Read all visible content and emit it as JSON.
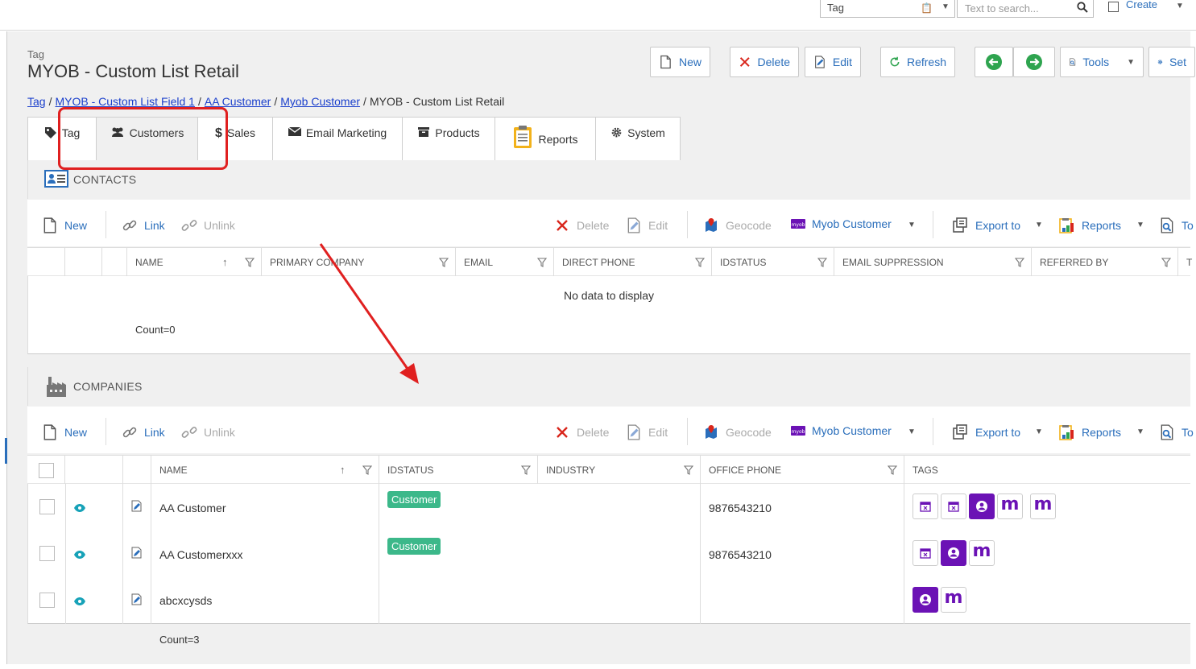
{
  "topbar": {
    "tag_select_value": "Tag",
    "search_placeholder": "Text to search...",
    "create_label": "Create"
  },
  "header": {
    "kicker": "Tag",
    "title": "MYOB - Custom List Retail"
  },
  "toolbar": {
    "new_label": "New",
    "delete_label": "Delete",
    "edit_label": "Edit",
    "refresh_label": "Refresh",
    "tools_label": "Tools",
    "settings_label": "Set"
  },
  "breadcrumb": {
    "items": [
      "Tag",
      "MYOB - Custom List Field 1",
      "AA Customer",
      "Myob Customer"
    ],
    "current": "MYOB - Custom List Retail",
    "sep": "/"
  },
  "tabs": [
    {
      "label": "Tag",
      "icon": "tag-icon"
    },
    {
      "label": "Customers",
      "icon": "users-icon"
    },
    {
      "label": "Sales",
      "icon": "dollar-icon"
    },
    {
      "label": "Email Marketing",
      "icon": "envelope-icon"
    },
    {
      "label": "Products",
      "icon": "inbox-icon"
    },
    {
      "label": "Reports",
      "icon": "clipboard-icon"
    },
    {
      "label": "System",
      "icon": "gear-icon"
    }
  ],
  "contacts": {
    "title": "CONTACTS",
    "tools": {
      "new": "New",
      "link": "Link",
      "unlink": "Unlink",
      "delete": "Delete",
      "edit": "Edit",
      "geocode": "Geocode",
      "myob": "Myob Customer",
      "export": "Export to",
      "reports": "Reports",
      "more": "To"
    },
    "columns": [
      "NAME",
      "PRIMARY COMPANY",
      "EMAIL",
      "DIRECT PHONE",
      "IDSTATUS",
      "EMAIL SUPPRESSION",
      "REFERRED BY",
      "T"
    ],
    "no_data": "No data to display",
    "count": "Count=0"
  },
  "companies": {
    "title": "COMPANIES",
    "tools": {
      "new": "New",
      "link": "Link",
      "unlink": "Unlink",
      "delete": "Delete",
      "edit": "Edit",
      "geocode": "Geocode",
      "myob": "Myob Customer",
      "export": "Export to",
      "reports": "Reports",
      "more": "To"
    },
    "columns": [
      "NAME",
      "IDSTATUS",
      "INDUSTRY",
      "OFFICE PHONE",
      "TAGS"
    ],
    "rows": [
      {
        "name": "AA Customer",
        "status": "Customer",
        "industry": "",
        "phone": "9876543210",
        "tags": [
          "calendar-x-icon",
          "calendar-x-icon",
          "person-badge-icon",
          "myob-icon",
          "myob-icon"
        ]
      },
      {
        "name": "AA Customerxxx",
        "status": "Customer",
        "industry": "",
        "phone": "9876543210",
        "tags": [
          "calendar-x-icon",
          "person-badge-icon",
          "myob-icon"
        ]
      },
      {
        "name": "abcxcysds",
        "status": "",
        "industry": "",
        "phone": "",
        "tags": [
          "person-badge-icon",
          "myob-icon"
        ]
      }
    ],
    "count": "Count=3"
  },
  "colors": {
    "accent": "#2a6ebb",
    "badge": "#3cb88a",
    "myob_purple": "#6b12b5",
    "annotation_red": "#e02020"
  }
}
